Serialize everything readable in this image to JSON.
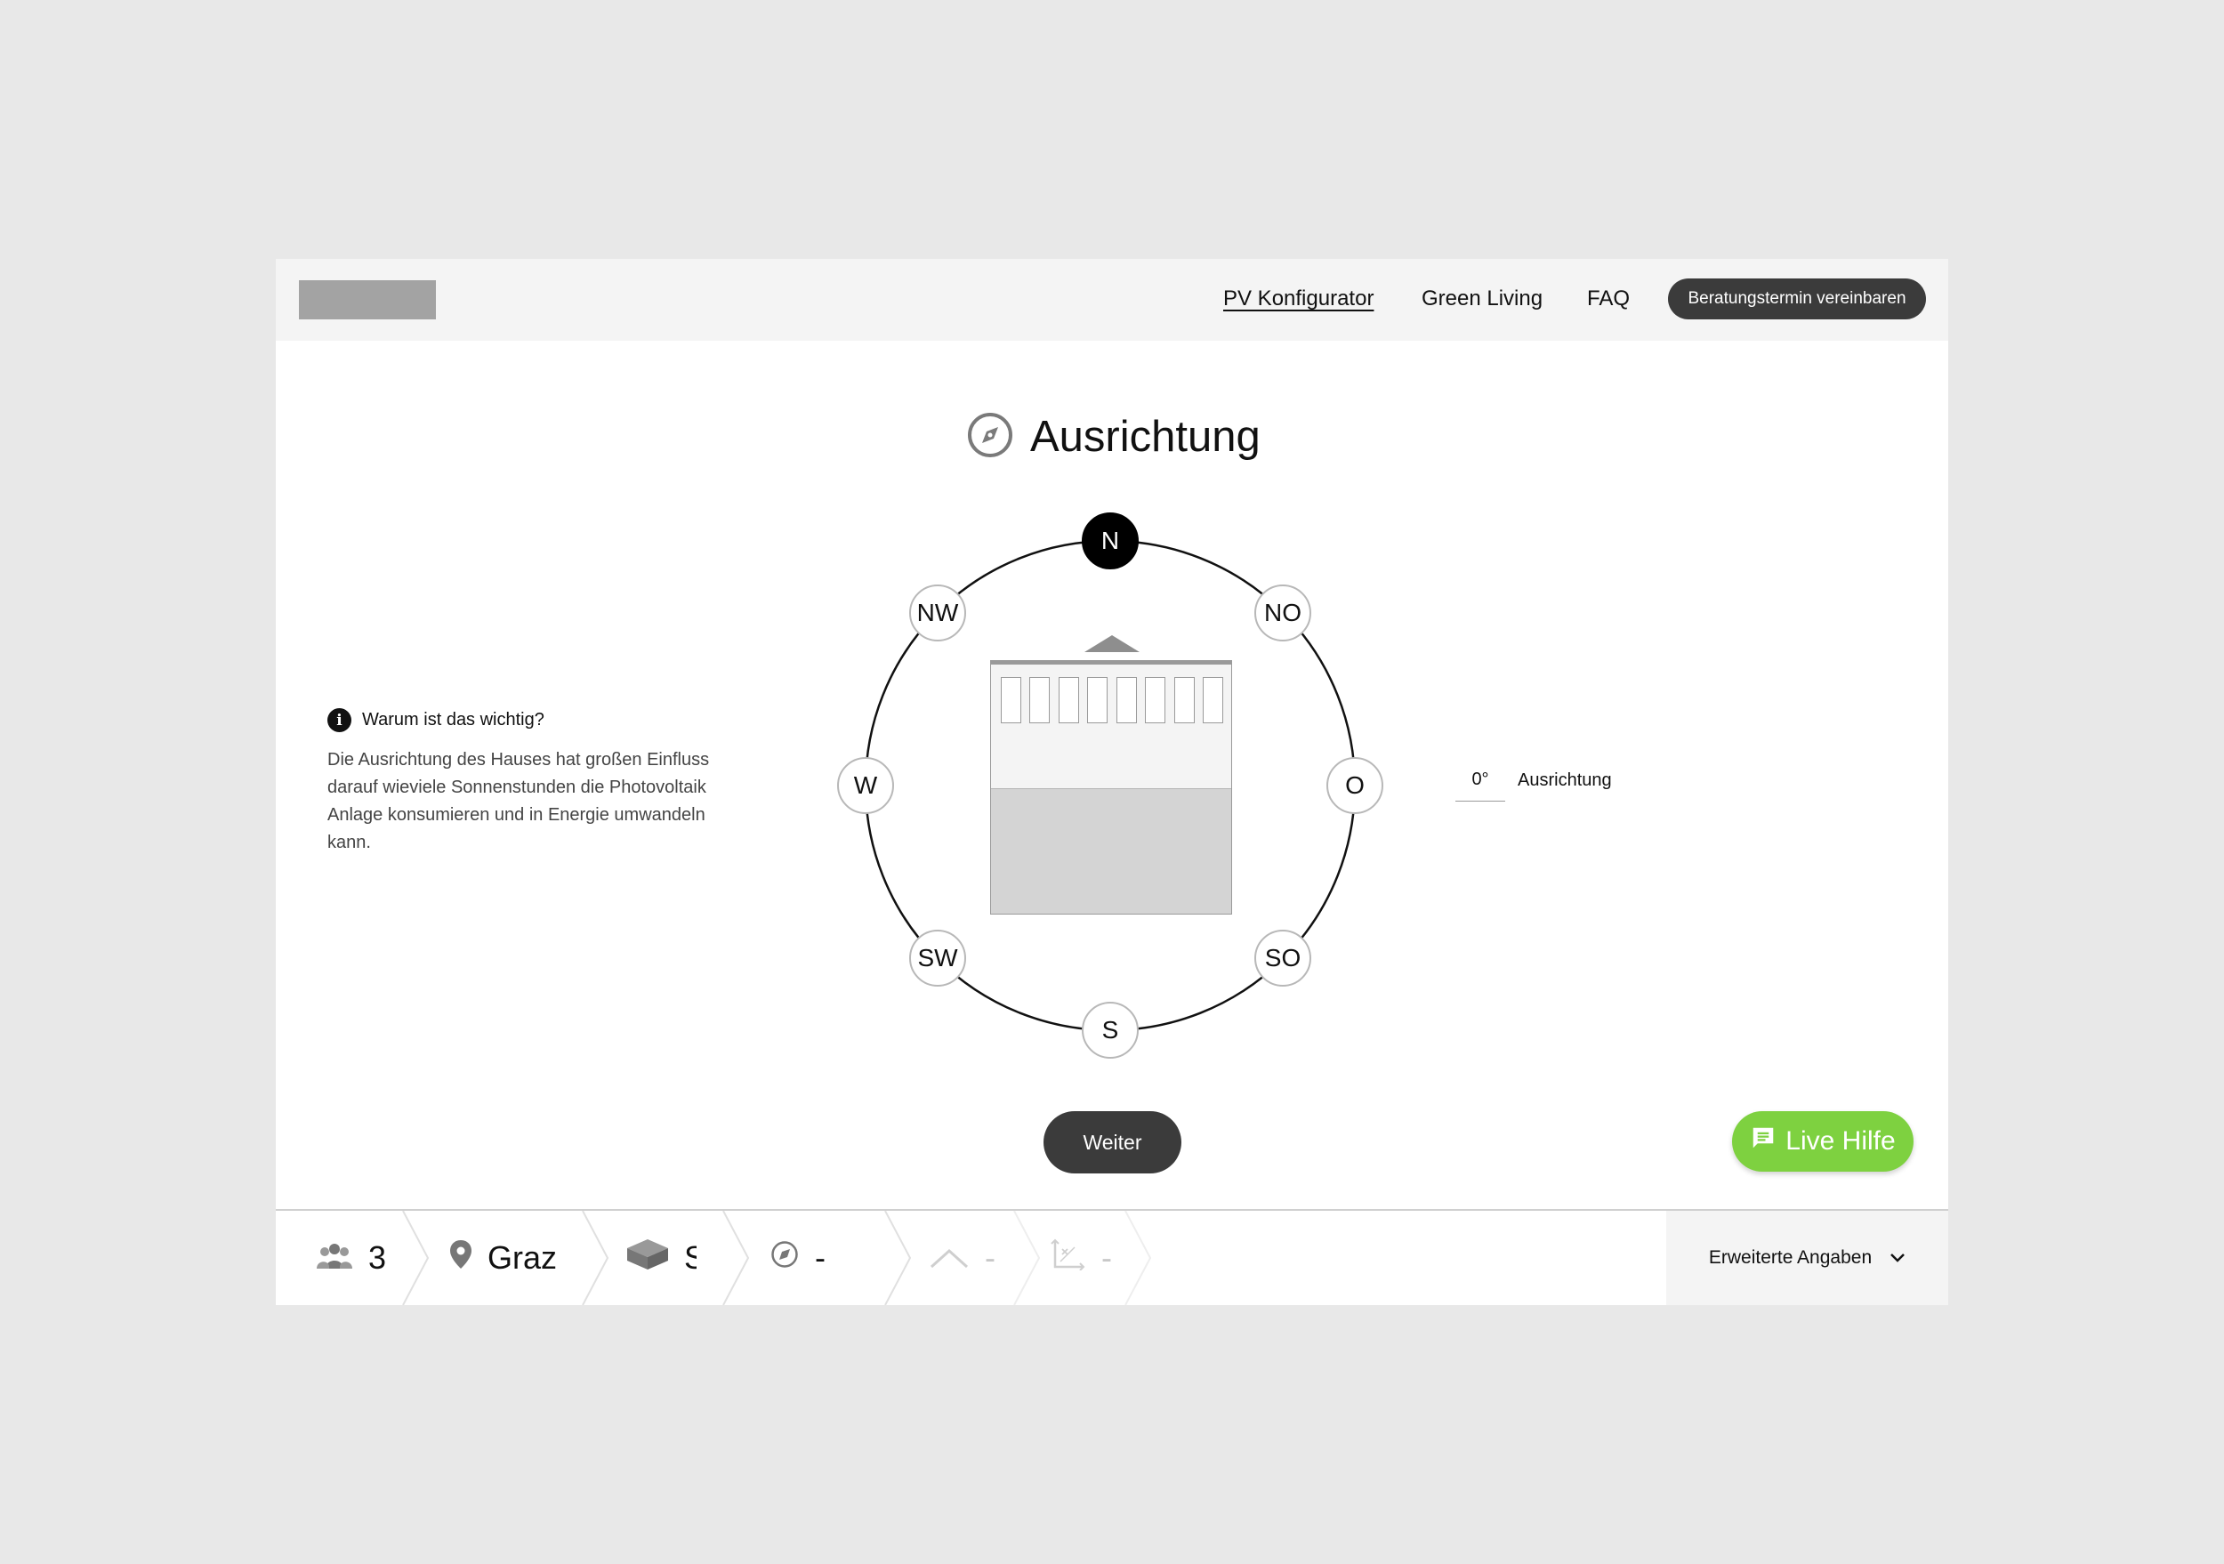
{
  "header": {
    "nav": [
      {
        "label": "PV Konfigurator",
        "active": true
      },
      {
        "label": "Green Living",
        "active": false
      },
      {
        "label": "FAQ",
        "active": false
      }
    ],
    "cta_label": "Beratungstermin vereinbaren"
  },
  "page": {
    "title": "Ausrichtung",
    "title_icon": "compass-icon"
  },
  "info": {
    "heading": "Warum ist das wichtig?",
    "body": "Die Ausrichtung des Hauses hat großen Einfluss darauf wieviele Sonnenstunden die Photovoltaik Anlage konsumieren und in Energie umwandeln kann."
  },
  "compass": {
    "directions": [
      "N",
      "NO",
      "O",
      "SO",
      "S",
      "SW",
      "W",
      "NW"
    ],
    "selected": "N"
  },
  "orientation": {
    "value": "0°",
    "label": "Ausrichtung"
  },
  "buttons": {
    "weiter": "Weiter",
    "live_help": "Live Hilfe"
  },
  "footer": {
    "steps": [
      {
        "icon": "people-icon",
        "value": "3",
        "enabled": true
      },
      {
        "icon": "location-pin-icon",
        "value": "Graz",
        "enabled": true
      },
      {
        "icon": "house-box-icon",
        "value": "S",
        "enabled": true
      },
      {
        "icon": "compass-icon",
        "value": "-",
        "enabled": true
      },
      {
        "icon": "roof-icon",
        "value": "-",
        "enabled": false
      },
      {
        "icon": "dimensions-icon",
        "value": "-",
        "enabled": false
      }
    ],
    "expand_label": "Erweiterte Angaben"
  },
  "colors": {
    "accent_green": "#7ed140",
    "dark_button": "#3b3b3b",
    "header_bg": "#f4f4f4",
    "page_bg": "#e8e8e8"
  }
}
